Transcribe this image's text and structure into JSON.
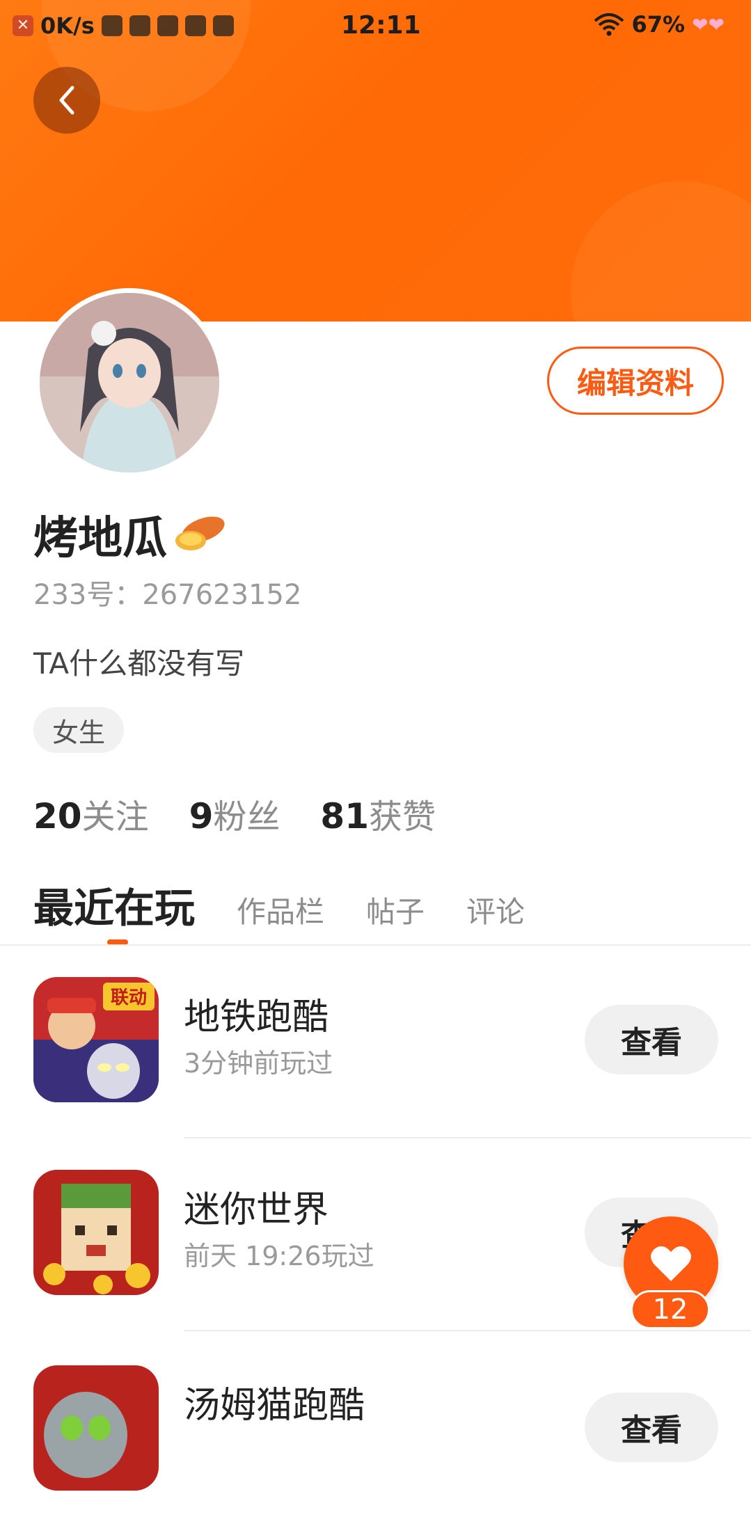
{
  "status_bar": {
    "net_speed": "0K/s",
    "time": "12:11",
    "battery": "67%"
  },
  "profile": {
    "edit_label": "编辑资料",
    "username": "烤地瓜",
    "id_line": "233号：267623152",
    "bio": "TA什么都没有写",
    "gender_tag": "女生"
  },
  "stats": [
    {
      "num": "20",
      "label": "关注"
    },
    {
      "num": "9",
      "label": "粉丝"
    },
    {
      "num": "81",
      "label": "获赞"
    }
  ],
  "tabs": [
    {
      "label": "最近在玩",
      "active": true
    },
    {
      "label": "作品栏"
    },
    {
      "label": "帖子"
    },
    {
      "label": "评论"
    }
  ],
  "games": [
    {
      "name": "地铁跑酷",
      "time": "3分钟前玩过",
      "button": "查看",
      "badge": "联动"
    },
    {
      "name": "迷你世界",
      "time": "前天 19:26玩过",
      "button": "查看"
    },
    {
      "name": "汤姆猫跑酷",
      "time": "",
      "button": "查看"
    }
  ],
  "like_fab": {
    "count": "12"
  },
  "colors": {
    "accent": "#ff5a12",
    "banner": "#ff6a06"
  }
}
